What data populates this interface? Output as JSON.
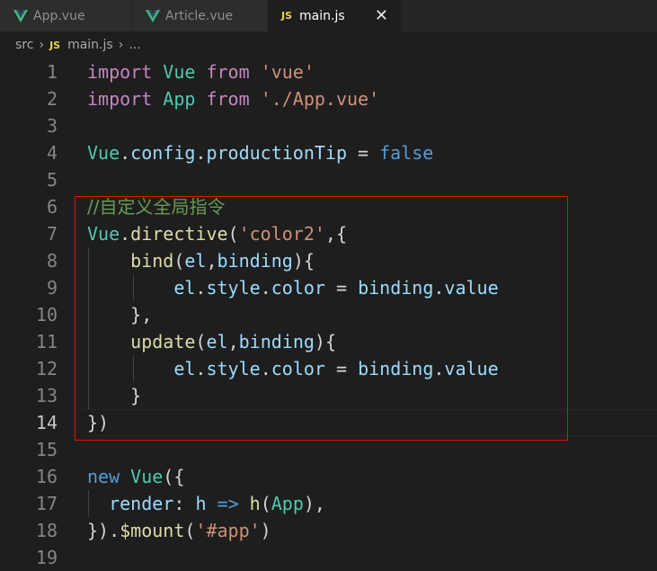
{
  "tabs": [
    {
      "label": "App.vue",
      "icon": "vue-icon",
      "active": false
    },
    {
      "label": "Article.vue",
      "icon": "vue-icon",
      "active": false
    },
    {
      "label": "main.js",
      "icon": "js-icon",
      "active": true
    }
  ],
  "tab_icon_text": {
    "js": "JS",
    "close": "✕"
  },
  "breadcrumb": {
    "folder": "src",
    "file": "main.js",
    "rest": "..."
  },
  "lines": [
    {
      "n": "1",
      "tokens": [
        [
          "kw",
          "import"
        ],
        [
          "op",
          " "
        ],
        [
          "id",
          "Vue"
        ],
        [
          "op",
          " "
        ],
        [
          "kw",
          "from"
        ],
        [
          "op",
          " "
        ],
        [
          "str",
          "'vue'"
        ]
      ]
    },
    {
      "n": "2",
      "tokens": [
        [
          "kw",
          "import"
        ],
        [
          "op",
          " "
        ],
        [
          "id",
          "App"
        ],
        [
          "op",
          " "
        ],
        [
          "kw",
          "from"
        ],
        [
          "op",
          " "
        ],
        [
          "str",
          "'./App.vue'"
        ]
      ]
    },
    {
      "n": "3",
      "tokens": []
    },
    {
      "n": "4",
      "tokens": [
        [
          "id",
          "Vue"
        ],
        [
          "op",
          "."
        ],
        [
          "prop",
          "config"
        ],
        [
          "op",
          "."
        ],
        [
          "prop",
          "productionTip"
        ],
        [
          "op",
          " = "
        ],
        [
          "kw2",
          "false"
        ]
      ]
    },
    {
      "n": "5",
      "tokens": []
    },
    {
      "n": "6",
      "tokens": [
        [
          "cm",
          "//自定义全局指令"
        ]
      ]
    },
    {
      "n": "7",
      "tokens": [
        [
          "id",
          "Vue"
        ],
        [
          "op",
          "."
        ],
        [
          "fn",
          "directive"
        ],
        [
          "op",
          "("
        ],
        [
          "str",
          "'color2'"
        ],
        [
          "op",
          ",{"
        ]
      ]
    },
    {
      "n": "8",
      "tokens": [
        [
          "op",
          "    "
        ],
        [
          "fn",
          "bind"
        ],
        [
          "op",
          "("
        ],
        [
          "var",
          "el"
        ],
        [
          "op",
          ","
        ],
        [
          "var",
          "binding"
        ],
        [
          "op",
          "){"
        ]
      ]
    },
    {
      "n": "9",
      "tokens": [
        [
          "op",
          "        "
        ],
        [
          "var",
          "el"
        ],
        [
          "op",
          "."
        ],
        [
          "prop",
          "style"
        ],
        [
          "op",
          "."
        ],
        [
          "prop",
          "color"
        ],
        [
          "op",
          " = "
        ],
        [
          "var",
          "binding"
        ],
        [
          "op",
          "."
        ],
        [
          "prop",
          "value"
        ]
      ]
    },
    {
      "n": "10",
      "tokens": [
        [
          "op",
          "    },"
        ]
      ]
    },
    {
      "n": "11",
      "tokens": [
        [
          "op",
          "    "
        ],
        [
          "fn",
          "update"
        ],
        [
          "op",
          "("
        ],
        [
          "var",
          "el"
        ],
        [
          "op",
          ","
        ],
        [
          "var",
          "binding"
        ],
        [
          "op",
          "){"
        ]
      ]
    },
    {
      "n": "12",
      "tokens": [
        [
          "op",
          "        "
        ],
        [
          "var",
          "el"
        ],
        [
          "op",
          "."
        ],
        [
          "prop",
          "style"
        ],
        [
          "op",
          "."
        ],
        [
          "prop",
          "color"
        ],
        [
          "op",
          " = "
        ],
        [
          "var",
          "binding"
        ],
        [
          "op",
          "."
        ],
        [
          "prop",
          "value"
        ]
      ]
    },
    {
      "n": "13",
      "tokens": [
        [
          "op",
          "    }"
        ]
      ]
    },
    {
      "n": "14",
      "tokens": [
        [
          "op",
          "})"
        ]
      ],
      "current": true
    },
    {
      "n": "15",
      "tokens": []
    },
    {
      "n": "16",
      "tokens": [
        [
          "kw2",
          "new"
        ],
        [
          "op",
          " "
        ],
        [
          "id",
          "Vue"
        ],
        [
          "op",
          "({"
        ]
      ]
    },
    {
      "n": "17",
      "tokens": [
        [
          "op",
          "  "
        ],
        [
          "var",
          "render"
        ],
        [
          "op",
          ": "
        ],
        [
          "var",
          "h"
        ],
        [
          "op",
          " "
        ],
        [
          "kw2",
          "=>"
        ],
        [
          "op",
          " "
        ],
        [
          "fn",
          "h"
        ],
        [
          "op",
          "("
        ],
        [
          "id",
          "App"
        ],
        [
          "op",
          "),"
        ]
      ]
    },
    {
      "n": "18",
      "tokens": [
        [
          "op",
          "})."
        ],
        [
          "fn",
          "$mount"
        ],
        [
          "op",
          "("
        ],
        [
          "str",
          "'#app'"
        ],
        [
          "op",
          ")"
        ]
      ]
    },
    {
      "n": "19",
      "tokens": []
    }
  ]
}
